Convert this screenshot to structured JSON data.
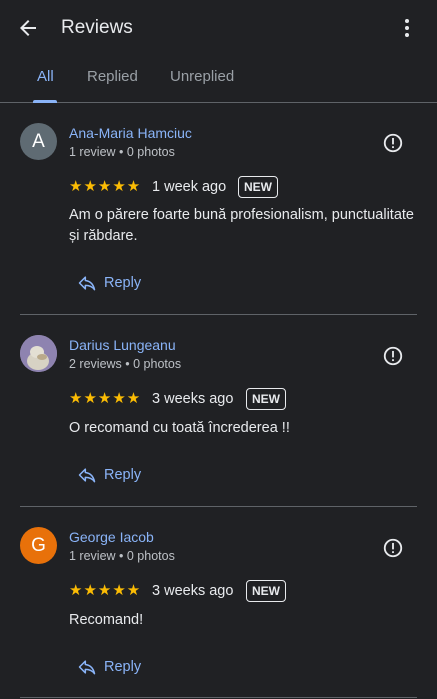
{
  "header": {
    "title": "Reviews"
  },
  "tabs": [
    "All",
    "Replied",
    "Unreplied"
  ],
  "reviews": [
    {
      "avatar_letter": "A",
      "avatar_color": "#5f6b73",
      "name": "Ana-Maria Hamciuc",
      "meta": "1 review • 0 photos",
      "stars": "★★★★★",
      "rating": 5,
      "date": "1 week ago",
      "badge": "NEW",
      "text": "Am o părere foarte bună profesionalism, punctualitate și răbdare.",
      "reply_label": "Reply"
    },
    {
      "avatar_letter": "",
      "avatar_color": "#9b8fb5",
      "name": "Darius Lungeanu",
      "meta": "2 reviews • 0 photos",
      "stars": "★★★★★",
      "rating": 5,
      "date": "3 weeks ago",
      "badge": "NEW",
      "text": "O recomand cu toată încrederea !!",
      "reply_label": "Reply"
    },
    {
      "avatar_letter": "G",
      "avatar_color": "#e8710a",
      "name": "George Iacob",
      "meta": "1 review • 0 photos",
      "stars": "★★★★★",
      "rating": 5,
      "date": "3 weeks ago",
      "badge": "NEW",
      "text": "Recomand!",
      "reply_label": "Reply"
    }
  ]
}
